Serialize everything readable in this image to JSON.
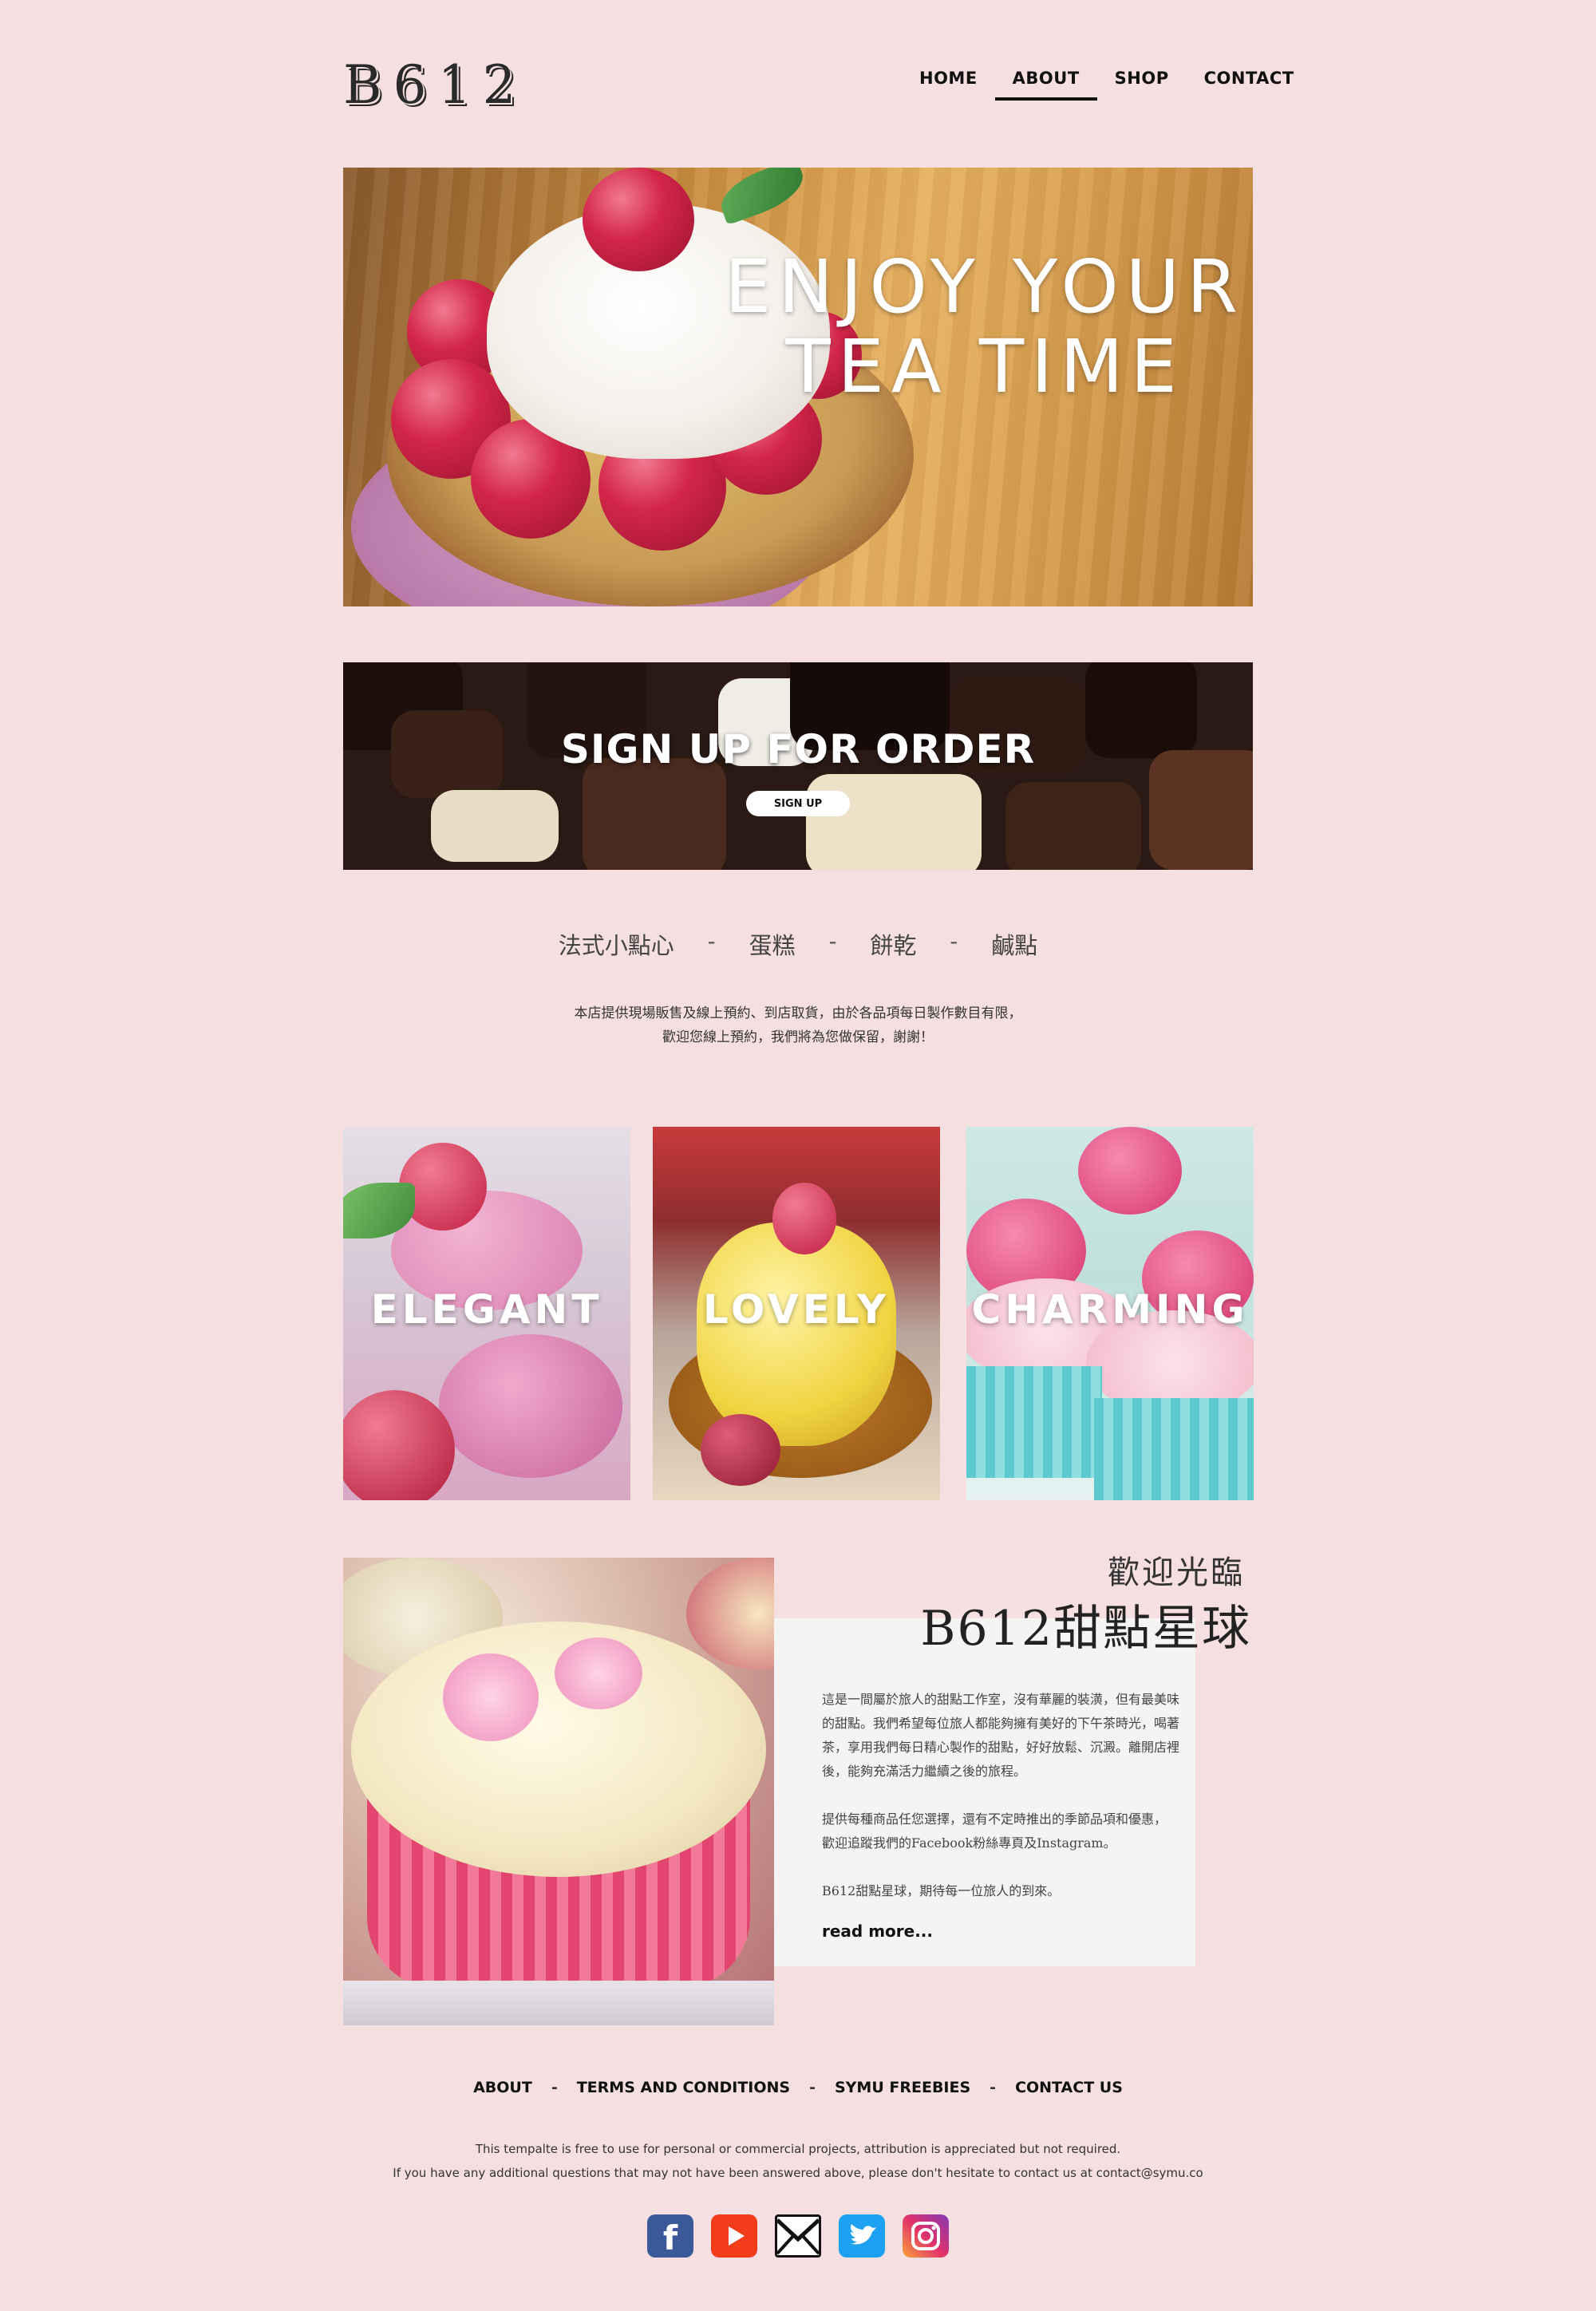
{
  "header": {
    "logo": "B612",
    "nav": [
      {
        "label": "HOME"
      },
      {
        "label": "ABOUT"
      },
      {
        "label": "SHOP"
      },
      {
        "label": "CONTACT"
      }
    ]
  },
  "hero": {
    "line1": "ENJOY YOUR",
    "line2": "TEA TIME"
  },
  "signup": {
    "title": "SIGN UP FOR ORDER",
    "button": "SIGN UP"
  },
  "categories": {
    "items": [
      "法式小點心",
      "蛋糕",
      "餅乾",
      "鹹點"
    ],
    "separator": "-"
  },
  "notice": {
    "line1": "本店提供現場販售及線上預約、到店取貨，由於各品項每日製作數目有限，",
    "line2": "歡迎您線上預約，我們將為您做保留，謝謝！"
  },
  "tiles": [
    {
      "label": "ELEGANT"
    },
    {
      "label": "LOVELY"
    },
    {
      "label": "CHARMING"
    }
  ],
  "welcome": {
    "small": "歡迎光臨",
    "big": "B612甜點星球",
    "p1_lines": [
      "這是一間屬於旅人的甜點工作室，沒有華麗的裝潢，但有最美味",
      "的甜點。我們希望每位旅人都能夠擁有美好的下午茶時光，喝著",
      "茶，享用我們每日精心製作的甜點，好好放鬆、沉澱。離開店裡",
      "後，能夠充滿活力繼續之後的旅程。"
    ],
    "p2_lines": [
      "提供每種商品任您選擇，還有不定時推出的季節品項和優惠，",
      "歡迎追蹤我們的Facebook粉絲專頁及Instagram。"
    ],
    "p3": "B612甜點星球，期待每一位旅人的到來。",
    "read_more": "read more..."
  },
  "footer": {
    "links": [
      "ABOUT",
      "TERMS AND CONDITIONS",
      "SYMU FREEBIES",
      "CONTACT US"
    ],
    "separator": "-",
    "line1": "This tempalte is free to use for personal or commercial projects, attribution is appreciated but not required.",
    "line2": "If you have any additional questions that may not have been answered above, please don't hesitate to contact us at contact@symu.co",
    "socials": [
      {
        "icon": "facebook-icon",
        "color": "#3b5998"
      },
      {
        "icon": "youtube-icon",
        "color": "#f23c1a"
      },
      {
        "icon": "mail-icon",
        "color": "#111111"
      },
      {
        "icon": "twitter-icon",
        "color": "#1da1f2"
      },
      {
        "icon": "instagram-icon",
        "color": "#c13584"
      }
    ]
  },
  "colors": {
    "background": "#f5dfe0",
    "panel": "#f4f4f4",
    "text": "#222222"
  }
}
